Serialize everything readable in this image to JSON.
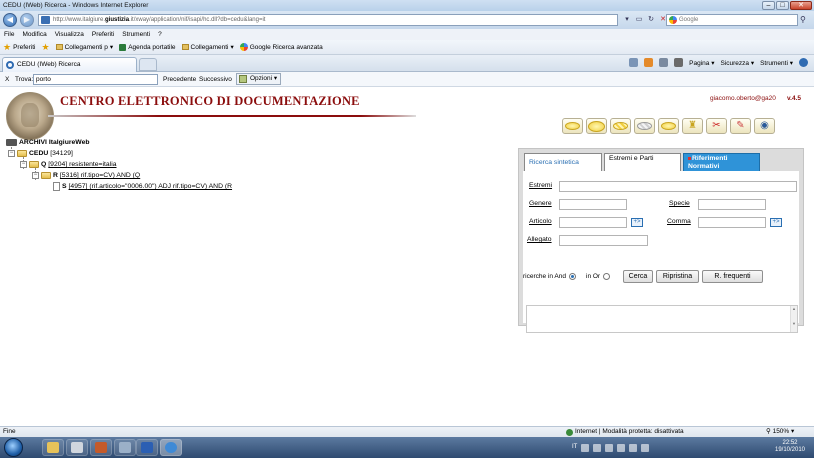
{
  "window": {
    "title": "CEDU (IWeb) Ricerca - Windows Internet Explorer",
    "controls": {
      "minimize": "–",
      "maximize": "□",
      "close": "✕"
    }
  },
  "addressbar": {
    "url_prefix": "http://www.italgiure.",
    "url_domain": "giustizia",
    "url_suffix": ".it/xway/application/nif/isapi/hc.dll?db=cedu&lang=it",
    "search_placeholder": "Google"
  },
  "menubar": [
    "File",
    "Modifica",
    "Visualizza",
    "Preferiti",
    "Strumenti",
    "?"
  ],
  "favorites": {
    "label": "Preferiti",
    "items": [
      "Collegamenti p",
      "Agenda portatile",
      "Collegamenti",
      "Google Ricerca avanzata"
    ]
  },
  "tabs": {
    "active_tab": "CEDU (IWeb) Ricerca"
  },
  "commandbar": [
    "Pagina",
    "Sicurezza",
    "Strumenti"
  ],
  "findbar": {
    "close": "X",
    "label": "Trova:",
    "value": "porto",
    "prev": "Precedente",
    "next": "Successivo",
    "options": "Opzioni"
  },
  "header": {
    "title": "CENTRO ELETTRONICO DI DOCUMENTAZIONE",
    "user": "giacomo.oberto@ga20",
    "version": "v.4.5"
  },
  "toolbar_icons": [
    "oval-1-icon",
    "oval-2-icon",
    "oval-3-icon",
    "oval-4-icon",
    "oval-5-icon",
    "person-icon",
    "scissors-icon",
    "eraser-icon",
    "help-icon"
  ],
  "tree": {
    "root": "ARCHIVI ItalgiureWeb",
    "cedu": {
      "label": "CEDU",
      "count": "[34129]"
    },
    "q": {
      "tag": "Q",
      "count": "[9204]",
      "query": "resistente=italia"
    },
    "r": {
      "tag": "R",
      "count": "[5316]",
      "query": "rif.tipo=CV) AND (Q"
    },
    "s": {
      "tag": "S",
      "count": "[4957]",
      "query": "(rif.articolo=\"0006.00\") ADJ rif.tipo=CV) AND (R"
    }
  },
  "panel": {
    "tabs": {
      "sintetica": "Ricerca sintetica",
      "estremi": "Estremi e Parti",
      "riferimenti": "Riferimenti Normativi"
    },
    "fields": {
      "estremi": "Estremi",
      "genere": "Genere",
      "specie": "Specie",
      "articolo": "Articolo",
      "comma": "Comma",
      "allegato": "Allegato"
    },
    "plus": "+>",
    "ricerche_in_and": "ricerche in And",
    "in_or": "in Or",
    "buttons": {
      "cerca": "Cerca",
      "ripristina": "Ripristina",
      "frequenti": "R. frequenti"
    }
  },
  "statusbar": {
    "left": "Fine",
    "zone": "Internet | Modalità protetta: disattivata",
    "zoom": "150%"
  },
  "taskbar": {
    "lang": "IT",
    "time": "22:52",
    "date": "19/10/2010"
  }
}
